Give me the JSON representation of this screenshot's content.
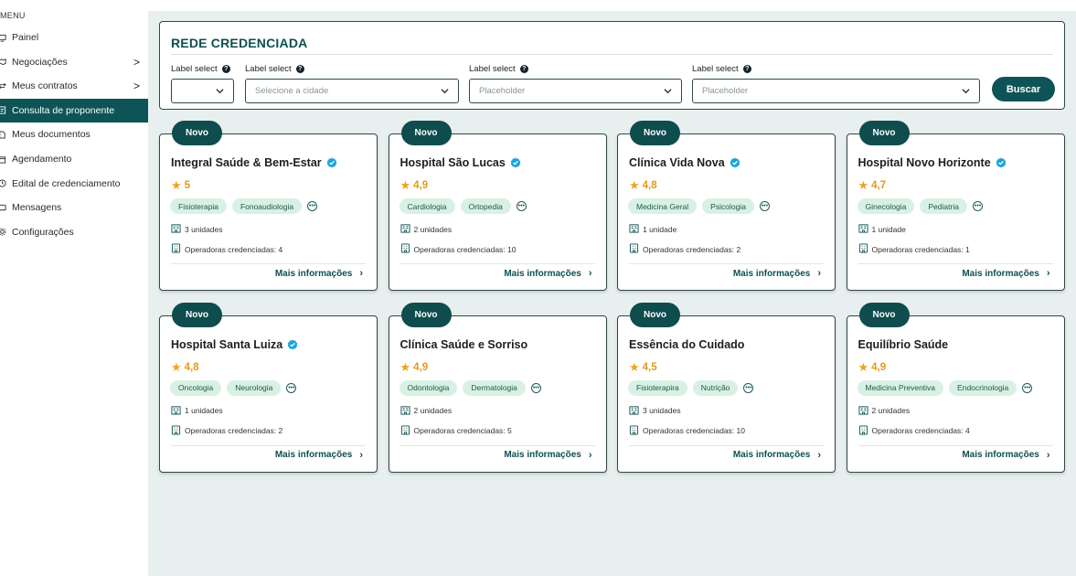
{
  "sidebar": {
    "menu_title": "MENU",
    "items": [
      {
        "label": "Painel",
        "icon": "monitor-icon",
        "chevron": "",
        "active": false
      },
      {
        "label": "Negociações",
        "icon": "handshake-icon",
        "chevron": ">",
        "active": false
      },
      {
        "label": "Meus contratos",
        "icon": "contract-icon",
        "chevron": ">",
        "active": false
      },
      {
        "label": "Consulta de proponente",
        "icon": "document-search-icon",
        "chevron": "",
        "active": true
      },
      {
        "label": "Meus documentos",
        "icon": "document-icon",
        "chevron": "",
        "active": false
      },
      {
        "label": "Agendamento",
        "icon": "calendar-icon",
        "chevron": "",
        "active": false
      },
      {
        "label": "Edital de credenciamento",
        "icon": "clock-icon",
        "chevron": "",
        "active": false
      },
      {
        "label": "Mensagens",
        "icon": "message-icon",
        "chevron": "",
        "active": false
      },
      {
        "label": "Configurações",
        "icon": "gear-icon",
        "chevron": "",
        "active": false
      }
    ]
  },
  "search": {
    "title": "REDE CREDENCIADA",
    "fields": [
      {
        "label": "Label select",
        "value": ""
      },
      {
        "label": "Label select",
        "value": "Selecione a cidade"
      },
      {
        "label": "Label select",
        "value": "Placeholder"
      },
      {
        "label": "Label select",
        "value": "Placeholder"
      }
    ],
    "button": "Buscar"
  },
  "cards": [
    {
      "badge": "Novo",
      "name": "Integral Saúde & Bem-Estar",
      "verified": true,
      "rating": "5",
      "tags": [
        "Fisioterapia",
        "Fonoaudiologia"
      ],
      "units": "3 unidades",
      "operators": "Operadoras credenciadas: 4",
      "more": "Mais informações"
    },
    {
      "badge": "Novo",
      "name": "Hospital São Lucas",
      "verified": true,
      "rating": "4,9",
      "tags": [
        "Cardiologia",
        "Ortopedia"
      ],
      "units": "2 unidades",
      "operators": "Operadoras credenciadas: 10",
      "more": "Mais informações"
    },
    {
      "badge": "Novo",
      "name": "Clínica Vida Nova",
      "verified": true,
      "rating": "4,8",
      "tags": [
        "Medicina Geral",
        "Psicologia"
      ],
      "units": "1 unidade",
      "operators": "Operadoras credenciadas: 2",
      "more": "Mais informações"
    },
    {
      "badge": "Novo",
      "name": "Hospital Novo Horizonte",
      "verified": true,
      "rating": "4,7",
      "tags": [
        "Ginecologia",
        "Pediatria"
      ],
      "units": "1 unidade",
      "operators": "Operadoras credenciadas: 1",
      "more": "Mais informações"
    },
    {
      "badge": "Novo",
      "name": "Hospital Santa Luiza",
      "verified": true,
      "rating": "4,8",
      "tags": [
        "Oncologia",
        "Neurologia"
      ],
      "units": "1 unidades",
      "operators": "Operadoras credenciadas: 2",
      "more": "Mais informações"
    },
    {
      "badge": "Novo",
      "name": "Clínica Saúde e Sorriso",
      "verified": false,
      "rating": "4,9",
      "tags": [
        "Odontologia",
        "Dermatologia"
      ],
      "units": "2 unidades",
      "operators": "Operadoras credenciadas: 5",
      "more": "Mais informações"
    },
    {
      "badge": "Novo",
      "name": "Essência do Cuidado",
      "verified": false,
      "rating": "4,5",
      "tags": [
        "Fisioterapira",
        "Nutrição"
      ],
      "units": "3 unidades",
      "operators": "Operadoras credenciadas: 10",
      "more": "Mais informações"
    },
    {
      "badge": "Novo",
      "name": "Equilíbrio Saúde",
      "verified": false,
      "rating": "4,9",
      "tags": [
        "Medicina Preventiva",
        "Endocrinologia"
      ],
      "units": "2 unidades",
      "operators": "Operadoras credenciadas: 4",
      "more": "Mais informações"
    }
  ],
  "colors": {
    "accent": "#0e5456",
    "badge": "#0e4c4e",
    "star": "#f0a31b",
    "tag_bg": "#d9f0e5",
    "verified": "#1ba4d8",
    "main_bg": "#e8f0ef"
  }
}
